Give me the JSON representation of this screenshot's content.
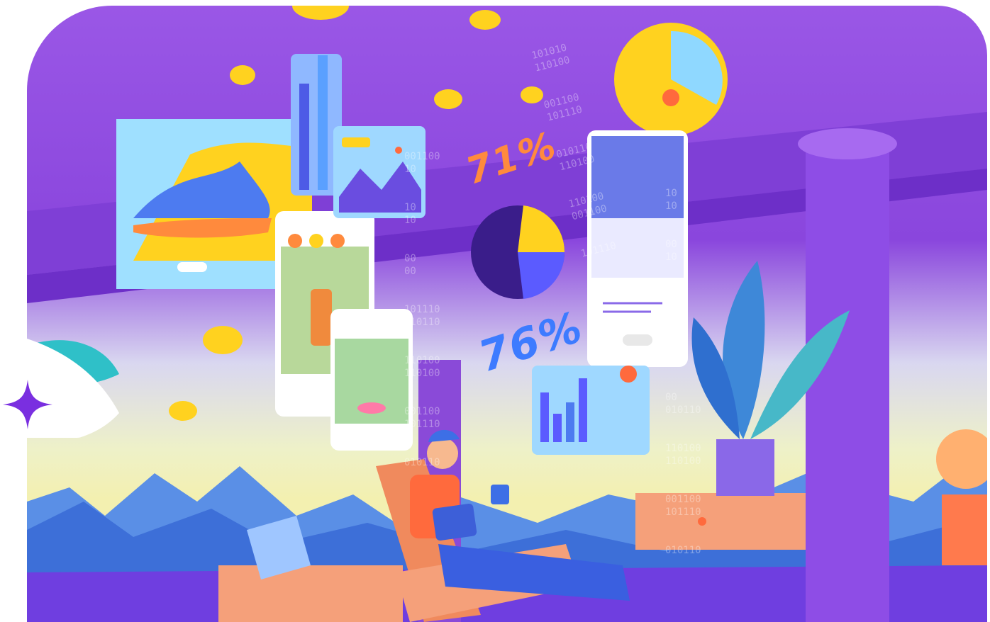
{
  "illustration": {
    "percent_top": "71%",
    "percent_bottom": "76%",
    "binary_column_left": [
      "001100",
      "10",
      "10",
      "10",
      "00",
      "00",
      "101110",
      "010110",
      "110100",
      "110100",
      "001100",
      "101110",
      "010110"
    ],
    "binary_column_right": [
      "101010",
      "110100",
      "001100",
      "101110",
      "010110",
      "110100",
      "110100",
      "001100",
      "101110"
    ],
    "binary_column_far": [
      "10",
      "10",
      "00",
      "10",
      "00",
      "00",
      "10",
      "10",
      "00",
      "010110",
      "110100",
      "110100",
      "001100",
      "101110",
      "010110"
    ]
  },
  "colors": {
    "sky_purple": "#9a57e6",
    "ceiling_purple": "#8a46dd",
    "accent_yellow": "#ffd21f",
    "accent_orange": "#ff8a3d",
    "accent_blue": "#3d7bff",
    "sparkle": "#7a2fe0"
  },
  "icons": [
    "sparkle-icon",
    "coin-icon",
    "clock-icon",
    "pie-chart-icon",
    "bar-chart-icon"
  ]
}
